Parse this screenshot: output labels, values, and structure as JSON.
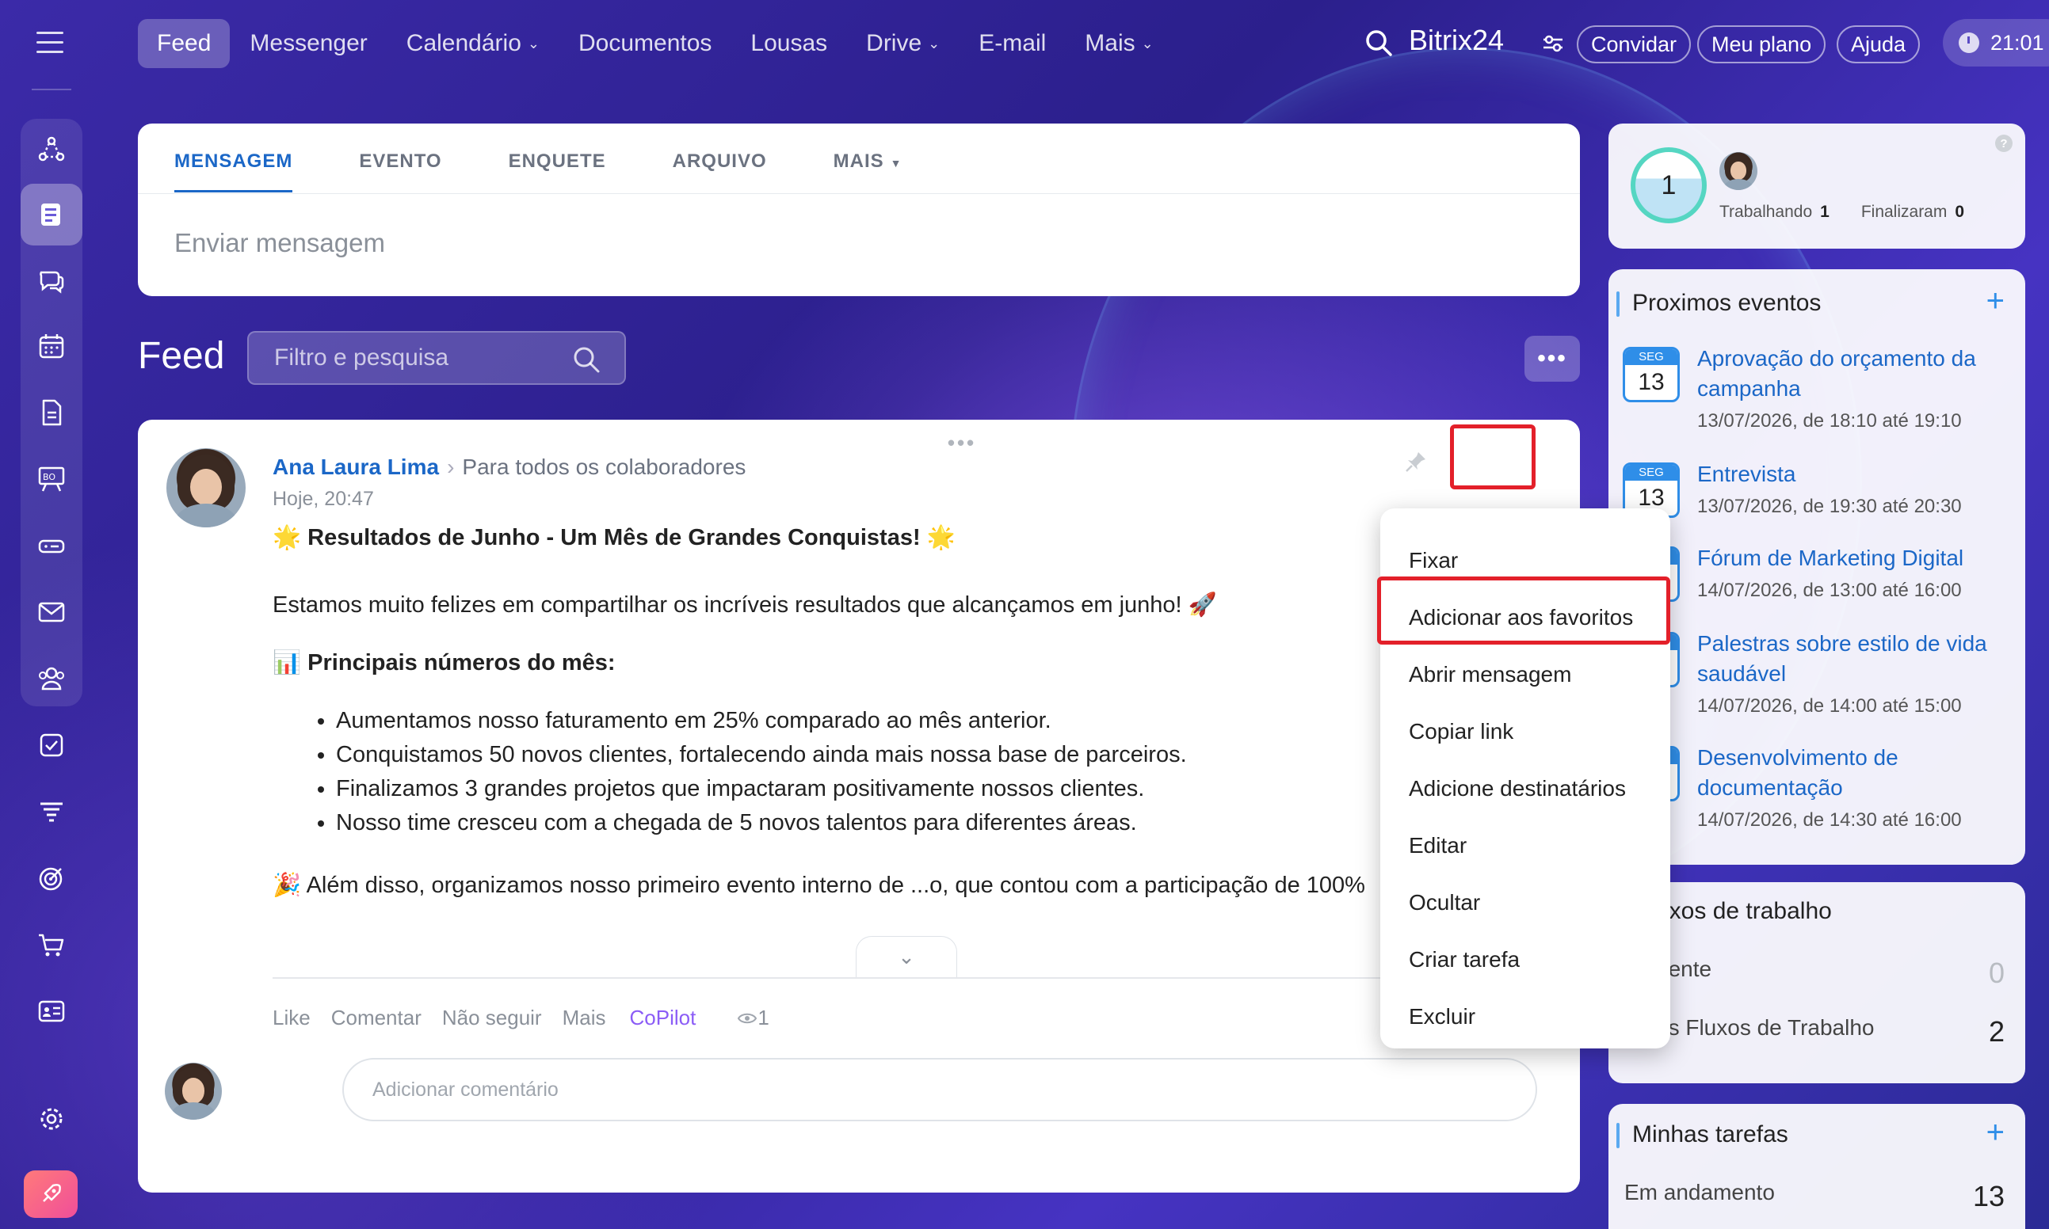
{
  "topbar": {
    "nav": [
      {
        "label": "Feed",
        "active": true,
        "dropdown": false
      },
      {
        "label": "Messenger",
        "active": false,
        "dropdown": false
      },
      {
        "label": "Calendário",
        "active": false,
        "dropdown": true
      },
      {
        "label": "Documentos",
        "active": false,
        "dropdown": false
      },
      {
        "label": "Lousas",
        "active": false,
        "dropdown": false
      },
      {
        "label": "Drive",
        "active": false,
        "dropdown": true
      },
      {
        "label": "E-mail",
        "active": false,
        "dropdown": false
      },
      {
        "label": "Mais",
        "active": false,
        "dropdown": true
      }
    ],
    "brand": "Bitrix24",
    "invite_label": "Convidar",
    "plan_label": "Meu plano",
    "help_label": "Ajuda",
    "clock": "21:01"
  },
  "sidebar": {
    "icons": [
      "sitemap-icon",
      "feed-icon",
      "chat-icon",
      "calendar-icon",
      "document-icon",
      "whiteboard-icon",
      "drive-icon",
      "mail-icon",
      "group-icon",
      "tasks-icon",
      "filter-icon",
      "target-icon",
      "cart-icon",
      "contact-card-icon",
      "settings-icon",
      "rocket-icon"
    ]
  },
  "composer": {
    "tabs": [
      "MENSAGEM",
      "EVENTO",
      "ENQUETE",
      "ARQUIVO",
      "MAIS"
    ],
    "placeholder": "Enviar mensagem"
  },
  "feed": {
    "title": "Feed",
    "search_placeholder": "Filtro e pesquisa"
  },
  "post": {
    "author": "Ana Laura Lima",
    "destination": "Para todos os colaboradores",
    "time": "Hoje, 20:47",
    "title": "🌟 Resultados de Junho - Um Mês de Grandes Conquistas! 🌟",
    "intro": "Estamos muito felizes em compartilhar os incríveis resultados que alcançamos em junho! 🚀",
    "subtitle": "📊 Principais números do mês:",
    "bullets": [
      "Aumentamos nosso faturamento em 25% comparado ao mês anterior.",
      "Conquistamos 50 novos clientes, fortalecendo ainda mais nossa base de parceiros.",
      "Finalizamos 3 grandes projetos que impactaram positivamente nossos clientes.",
      "Nosso time cresceu com a chegada de 5 novos talentos para diferentes áreas."
    ],
    "truncated_line": "🎉 Além disso, organizamos nosso primeiro evento interno de ...o, que contou com a participação de 100%",
    "actions": {
      "like": "Like",
      "comment": "Comentar",
      "unfollow": "Não seguir",
      "more": "Mais",
      "copilot": "CoPilot",
      "views": "1"
    },
    "comment_placeholder": "Adicionar comentário"
  },
  "context_menu": {
    "items": [
      "Fixar",
      "Adicionar aos favoritos",
      "Abrir mensagem",
      "Copiar link",
      "Adicione destinatários",
      "Editar",
      "Ocultar",
      "Criar tarefa",
      "Excluir"
    ],
    "highlighted": "Adicionar aos favoritos"
  },
  "timeman": {
    "count": "1",
    "working_label": "Trabalhando",
    "working_count": "1",
    "finished_label": "Finalizaram",
    "finished_count": "0"
  },
  "events": {
    "title": "Proximos eventos",
    "items": [
      {
        "month": "SEG",
        "day": "13",
        "title": "Aprovação do orçamento da campanha",
        "time": "13/07/2026, de 18:10 até 19:10"
      },
      {
        "month": "SEG",
        "day": "13",
        "title": "Entrevista",
        "time": "13/07/2026, de 19:30 até 20:30"
      },
      {
        "month": "",
        "day": "",
        "title": "Fórum de Marketing Digital",
        "time": "14/07/2026, de 13:00 até 16:00"
      },
      {
        "month": "",
        "day": "",
        "title": "Palestras sobre estilo de vida saudável",
        "time": "14/07/2026, de 14:00 até 15:00"
      },
      {
        "month": "",
        "day": "",
        "title": "Desenvolvimento de documentação",
        "time": "14/07/2026, de 14:30 até 16:00"
      }
    ]
  },
  "flows": {
    "title": "uxos de trabalho",
    "rows": [
      {
        "label": "dente",
        "count": "0"
      },
      {
        "label": "us Fluxos de Trabalho",
        "count": "2"
      }
    ]
  },
  "tasks": {
    "title": "Minhas tarefas",
    "row_label": "Em andamento",
    "row_count": "13"
  },
  "colors": {
    "accent": "#1b67c7",
    "highlight": "#e3202a",
    "copilot": "#8b5cf6"
  }
}
